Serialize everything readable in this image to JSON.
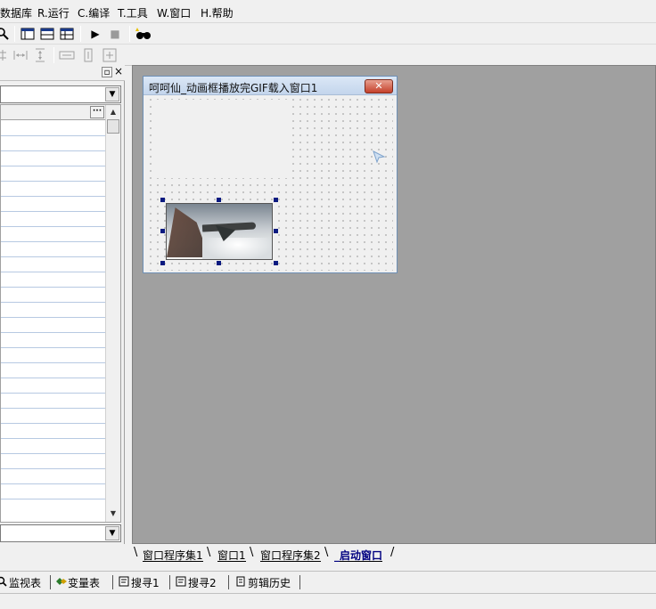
{
  "menu": {
    "items": [
      {
        "label": "数据库"
      },
      {
        "label": "R.运行"
      },
      {
        "label": "C.编译"
      },
      {
        "label": "T.工具"
      },
      {
        "label": "W.窗口"
      },
      {
        "label": "H.帮助"
      }
    ]
  },
  "toolbar": {
    "icons": [
      "search-icon",
      "layout-window-icon",
      "layout-split-icon",
      "layout-grid-icon",
      "run-icon",
      "stop-icon",
      "binoculars-icon"
    ],
    "run_glyph": "▶",
    "stop_glyph": "■"
  },
  "left_panel": {
    "pin_glyph": "▫",
    "close_glyph": "×",
    "dropdown_glyph": "▼",
    "grid_more_label": "···",
    "scroll_up_glyph": "▲",
    "scroll_down_glyph": "▼"
  },
  "form": {
    "title": "呵呵仙_动画框播放完GIF载入窗口1",
    "close_glyph": "✕"
  },
  "tabs": [
    {
      "label": "窗口程序集1",
      "active": false
    },
    {
      "label": "窗口1",
      "active": false
    },
    {
      "label": "窗口程序集2",
      "active": false
    },
    {
      "label": "_启动窗口",
      "active": true
    }
  ],
  "bottom_tabs": [
    {
      "label": "监视表",
      "icon": "magnifier-icon"
    },
    {
      "label": "变量表",
      "icon": "variables-icon"
    },
    {
      "label": "搜寻1",
      "icon": "search-list-icon"
    },
    {
      "label": "搜寻2",
      "icon": "search-list-icon"
    },
    {
      "label": "剪辑历史",
      "icon": "clipboard-icon"
    }
  ],
  "colors": {
    "workspace": "#a0a0a0",
    "selection_handle": "#0a1a80",
    "active_tab": "#000080",
    "close_button": "#c4402a"
  }
}
